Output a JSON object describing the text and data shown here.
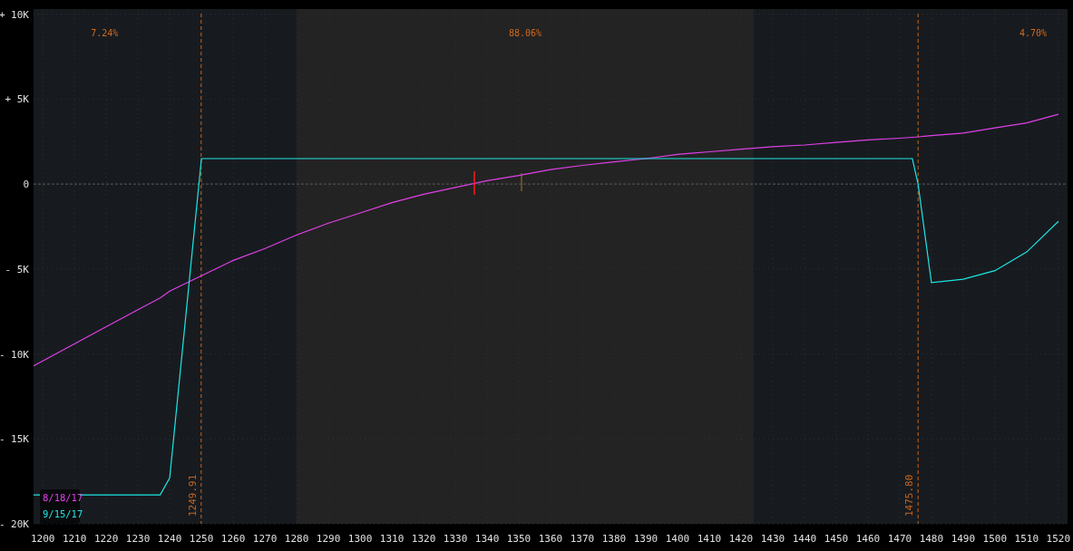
{
  "chart_data": {
    "type": "line",
    "grid": true,
    "x": [
      1197.1,
      1220,
      1230,
      1237,
      1240,
      1250,
      1260,
      1270,
      1280,
      1290,
      1300,
      1310,
      1320,
      1330,
      1340,
      1350,
      1360,
      1370,
      1380,
      1390,
      1400,
      1410,
      1420,
      1430,
      1440,
      1450,
      1460,
      1470,
      1474,
      1475.8,
      1480,
      1490,
      1500,
      1510,
      1520
    ],
    "series": [
      {
        "name": "8/18/17",
        "color": "#e040e8",
        "values": [
          -10700,
          -8400,
          -7400,
          -6700,
          -6300,
          -5400,
          -4500,
          -3800,
          -3000,
          -2300,
          -1700,
          -1100,
          -600,
          -200,
          200,
          500,
          850,
          1100,
          1300,
          1500,
          1750,
          1900,
          2050,
          2200,
          2300,
          2450,
          2600,
          2700,
          2750,
          2780,
          2850,
          3000,
          3300,
          3600,
          4100
        ]
      },
      {
        "name": "9/15/17",
        "color": "#1ee6e6",
        "values": [
          -18300,
          -18300,
          -18300,
          -18300,
          -17300,
          1500,
          1500,
          1500,
          1500,
          1500,
          1500,
          1500,
          1500,
          1500,
          1500,
          1500,
          1500,
          1500,
          1500,
          1500,
          1500,
          1500,
          1500,
          1500,
          1500,
          1500,
          1500,
          1500,
          1500,
          0,
          -5800,
          -5600,
          -5100,
          -4000,
          -2200
        ]
      }
    ],
    "xlim": [
      1197.1,
      1522.9
    ],
    "ylim": [
      -20000,
      10300
    ],
    "xticks": [
      1200,
      1210,
      1220,
      1230,
      1240,
      1250,
      1260,
      1270,
      1280,
      1290,
      1300,
      1310,
      1320,
      1330,
      1340,
      1350,
      1360,
      1370,
      1380,
      1390,
      1400,
      1410,
      1420,
      1430,
      1440,
      1450,
      1460,
      1470,
      1480,
      1490,
      1500,
      1510,
      1520
    ],
    "yticks": [
      {
        "value": 10000,
        "label": "+ 10K"
      },
      {
        "value": 5000,
        "label": "+ 5K"
      },
      {
        "value": 0,
        "label": "0"
      },
      {
        "value": -5000,
        "label": "- 5K"
      },
      {
        "value": -10000,
        "label": "- 10K"
      },
      {
        "value": -15000,
        "label": "- 15K"
      },
      {
        "value": -20000,
        "label": "- 20K"
      }
    ],
    "bands": [
      {
        "axis": "x",
        "from": 1280,
        "to": 1424
      }
    ],
    "ref_lines": [
      {
        "axis": "y",
        "value": 0
      },
      {
        "axis": "x",
        "value": 1249.91,
        "label": "1249.91"
      },
      {
        "axis": "x",
        "value": 1475.8,
        "label": "1475.80"
      }
    ],
    "annotations": [
      "7.24%",
      "88.06%",
      "4.70%"
    ]
  }
}
